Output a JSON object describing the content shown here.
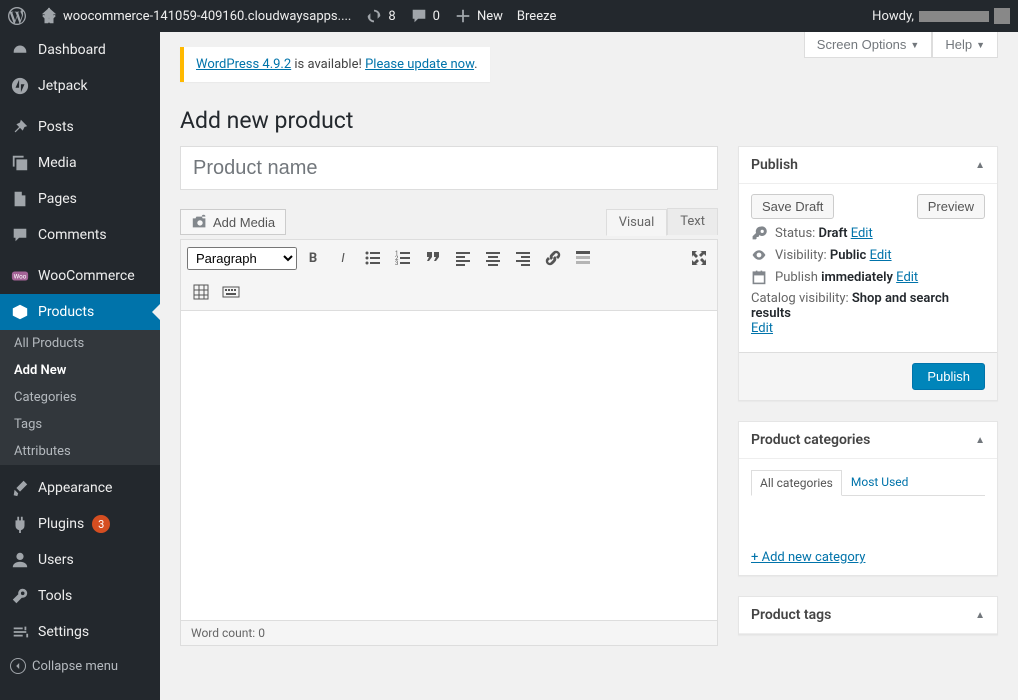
{
  "adminbar": {
    "site_name": "woocommerce-141059-409160.cloudwaysapps....",
    "updates": "8",
    "comments": "0",
    "new_label": "New",
    "breeze_label": "Breeze",
    "howdy": "Howdy,"
  },
  "sidebar": {
    "items": [
      {
        "label": "Dashboard"
      },
      {
        "label": "Jetpack"
      },
      {
        "label": "Posts"
      },
      {
        "label": "Media"
      },
      {
        "label": "Pages"
      },
      {
        "label": "Comments"
      },
      {
        "label": "WooCommerce"
      },
      {
        "label": "Products"
      },
      {
        "label": "Appearance"
      },
      {
        "label": "Plugins",
        "badge": "3"
      },
      {
        "label": "Users"
      },
      {
        "label": "Tools"
      },
      {
        "label": "Settings"
      }
    ],
    "products_submenu": [
      "All Products",
      "Add New",
      "Categories",
      "Tags",
      "Attributes"
    ],
    "collapse": "Collapse menu"
  },
  "screen_meta": {
    "options": "Screen Options",
    "help": "Help"
  },
  "notice": {
    "link1": "WordPress 4.9.2",
    "text": " is available! ",
    "link2": "Please update now"
  },
  "page_title": "Add new product",
  "title_placeholder": "Product name",
  "media_btn": "Add Media",
  "editor": {
    "tabs": [
      "Visual",
      "Text"
    ],
    "paragraph": "Paragraph",
    "word_count_label": "Word count: ",
    "word_count": "0"
  },
  "publish": {
    "title": "Publish",
    "save_draft": "Save Draft",
    "preview": "Preview",
    "status_label": "Status: ",
    "status_value": "Draft",
    "edit": "Edit",
    "visibility_label": "Visibility: ",
    "visibility_value": "Public",
    "schedule_label": "Publish ",
    "schedule_value": "immediately",
    "catalog_label": "Catalog visibility: ",
    "catalog_value": "Shop and search results",
    "publish_btn": "Publish"
  },
  "product_cat": {
    "title": "Product categories",
    "all": "All categories",
    "most": "Most Used",
    "add": "+ Add new category"
  },
  "product_tags": {
    "title": "Product tags"
  }
}
